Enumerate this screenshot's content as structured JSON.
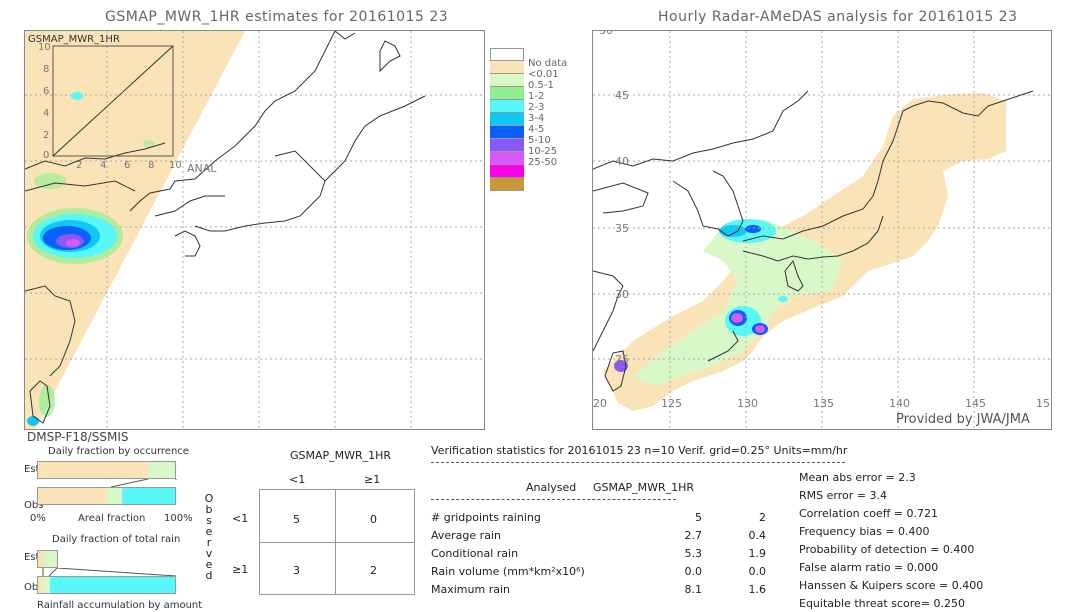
{
  "left_panel": {
    "title": "GSMAP_MWR_1HR estimates for 20161015 23",
    "inset_label": "GSMAP_MWR_1HR",
    "inset_y_ticks": [
      "10",
      "8",
      "6",
      "4",
      "2",
      "0"
    ],
    "inset_x_ticks": [
      "2",
      "4",
      "6",
      "8",
      "10"
    ],
    "inset_x_label": "ANAL",
    "sensor": "DMSP-F18/SSMIS"
  },
  "right_panel": {
    "title": "Hourly Radar-AMeDAS analysis for 20161015 23",
    "lat_ticks": [
      "45",
      "40",
      "35",
      "30",
      "25"
    ],
    "lat_top": "50",
    "lon_ticks": [
      "20",
      "125",
      "130",
      "135",
      "140",
      "145",
      "15"
    ],
    "credit": "Provided by JWA/JMA"
  },
  "legend": {
    "items": [
      {
        "label": "",
        "color": "#ffffff"
      },
      {
        "label": "No data",
        "color": "#fbe3b8"
      },
      {
        "label": "<0.01",
        "color": "#d8f8c8"
      },
      {
        "label": "0.5-1",
        "color": "#90f090"
      },
      {
        "label": "1-2",
        "color": "#58f8f8"
      },
      {
        "label": "2-3",
        "color": "#10c8f8"
      },
      {
        "label": "3-4",
        "color": "#0860f8"
      },
      {
        "label": "4-5",
        "color": "#8858f8"
      },
      {
        "label": "5-10",
        "color": "#d858f8"
      },
      {
        "label": "10-25",
        "color": "#f800e8"
      },
      {
        "label": "25-50",
        "color": "#c89838"
      }
    ]
  },
  "fraction_charts": {
    "occurrence_title": "Daily fraction by occurrence",
    "est_label": "Est",
    "obs_label": "Obs",
    "axis_left": "0%",
    "axis_center": "Areal fraction",
    "axis_right": "100%",
    "occurrence_est": [
      {
        "color": "#fbe3b8",
        "frac": 0.8
      },
      {
        "color": "#d8f8c8",
        "frac": 0.2
      }
    ],
    "occurrence_obs": [
      {
        "color": "#fbe3b8",
        "frac": 0.5
      },
      {
        "color": "#d8f8c8",
        "frac": 0.11
      },
      {
        "color": "#58f8f8",
        "frac": 0.39
      }
    ],
    "total_title": "Daily fraction of total rain",
    "total_est": [
      {
        "color": "#fbe3b8",
        "frac": 0.05
      },
      {
        "color": "#d8f8c8",
        "frac": 0.1
      }
    ],
    "total_obs": [
      {
        "color": "#fbe3b8",
        "frac": 0.04
      },
      {
        "color": "#d8f8c8",
        "frac": 0.05
      },
      {
        "color": "#58f8f8",
        "frac": 0.91
      }
    ],
    "accum_title": "Rainfall accumulation by amount"
  },
  "contingency": {
    "title": "GSMAP_MWR_1HR",
    "col_headers": [
      "<1",
      "≥1"
    ],
    "row_headers": [
      "<1",
      "≥1"
    ],
    "side_label": [
      "O",
      "b",
      "s",
      "e",
      "r",
      "v",
      "e",
      "d"
    ],
    "cells": [
      [
        "5",
        "0"
      ],
      [
        "3",
        "2"
      ]
    ]
  },
  "verification": {
    "header": "Verification statistics for 20161015 23   n=10   Verif. grid=0.25°   Units=mm/hr",
    "col_analysed": "Analysed",
    "col_gsmap": "GSMAP_MWR_1HR",
    "rows": [
      {
        "label": "# gridpoints raining",
        "analysed": "5",
        "gsmap": "2"
      },
      {
        "label": "Average rain",
        "analysed": "2.7",
        "gsmap": "0.4"
      },
      {
        "label": "Conditional rain",
        "analysed": "5.3",
        "gsmap": "1.9"
      },
      {
        "label": "Rain volume (mm*km²x10⁶)",
        "analysed": "0.0",
        "gsmap": "0.0"
      },
      {
        "label": "Maximum rain",
        "analysed": "8.1",
        "gsmap": "1.6"
      }
    ],
    "scores": [
      "Mean abs error = 2.3",
      "RMS error = 3.4",
      "Correlation coeff = 0.721",
      "Frequency bias = 0.400",
      "Probability of detection = 0.400",
      "False alarm ratio = 0.000",
      "Hanssen & Kuipers score = 0.400",
      "Equitable threat score= 0.250"
    ]
  }
}
